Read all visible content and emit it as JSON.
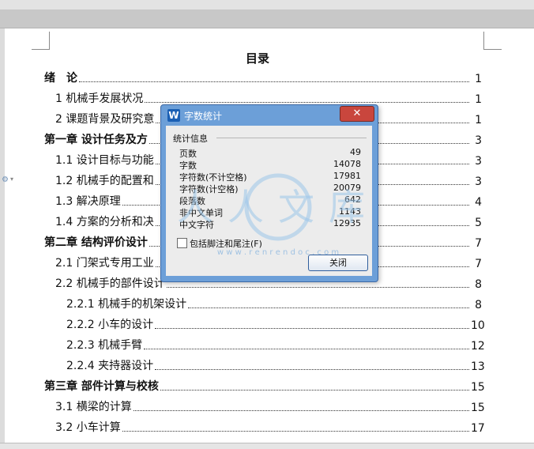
{
  "toc": {
    "title": "目录",
    "entries": [
      {
        "text": "绪　论",
        "page": "1",
        "bold": true
      },
      {
        "text": "1 机械手发展状况",
        "page": "1"
      },
      {
        "text": "2 课题背景及研究意",
        "page": "1"
      },
      {
        "text": "第一章  设计任务及方",
        "page": "3",
        "bold": true
      },
      {
        "text": "1.1 设计目标与功能",
        "page": "3"
      },
      {
        "text": "1.2 机械手的配置和",
        "page": "3"
      },
      {
        "text": "1.3 解决原理",
        "page": "4"
      },
      {
        "text": "1.4 方案的分析和决",
        "page": "5"
      },
      {
        "text": "第二章  结构评价设计",
        "page": "7",
        "bold": true
      },
      {
        "text": "2.1 门架式专用工业",
        "page": "7"
      },
      {
        "text": "2.2 机械手的部件设计",
        "page": "8"
      },
      {
        "text": "2.2.1 机械手的机架设计",
        "page": "8"
      },
      {
        "text": "2.2.2 小车的设计",
        "page": "10"
      },
      {
        "text": "2.2.3 机械手臂",
        "page": "12"
      },
      {
        "text": "2.2.4 夹持器设计",
        "page": "13"
      },
      {
        "text": "第三章  部件计算与校核",
        "page": "15",
        "bold": true
      },
      {
        "text": "3.1 横梁的计算",
        "page": "15"
      },
      {
        "text": "3.2 小车计算",
        "page": "17"
      }
    ]
  },
  "dialog": {
    "title": "字数统计",
    "app_icon_letter": "W",
    "close_glyph": "✕",
    "group_label": "统计信息",
    "stats": [
      {
        "label": "页数",
        "value": "49"
      },
      {
        "label": "字数",
        "value": "14078"
      },
      {
        "label": "字符数(不计空格)",
        "value": "17981"
      },
      {
        "label": "字符数(计空格)",
        "value": "20079"
      },
      {
        "label": "段落数",
        "value": "642"
      },
      {
        "label": "非中文单词",
        "value": "1143"
      },
      {
        "label": "中文字符",
        "value": "12935"
      }
    ],
    "checkbox_label": "包括脚注和尾注(F)",
    "checkbox_checked": false,
    "close_button": "关闭"
  },
  "watermark": {
    "chars": "人人文库",
    "url": "w w w . r e n r e n d o c . c o m"
  },
  "colors": {
    "dialog_frame": "#6c9fd8",
    "close_red": "#c9463d",
    "watermark": "#9cc6ea"
  }
}
